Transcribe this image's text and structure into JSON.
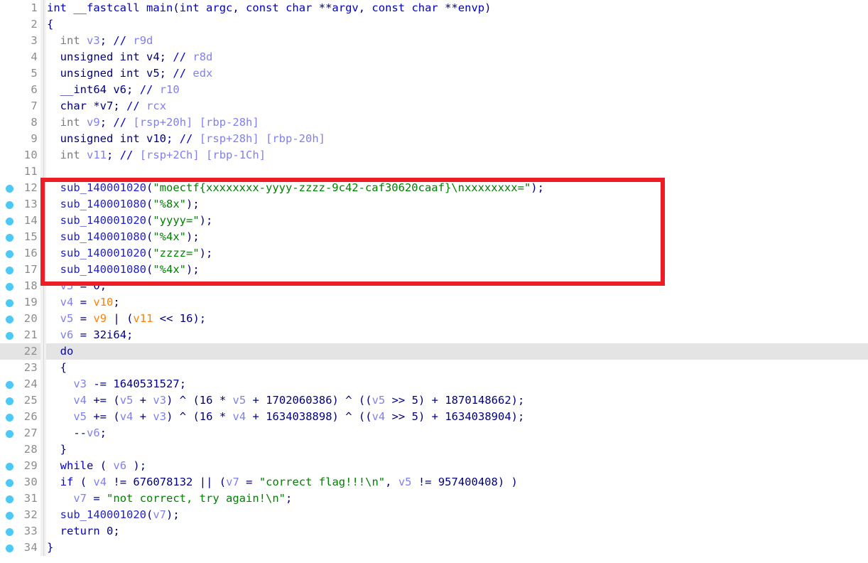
{
  "app": {
    "view_name": "pseudocode-view",
    "accent_breakpoint_color": "#4cc9f5",
    "annotation_color": "#ee1c25",
    "current_line_color": "#e4e4e4",
    "string_color": "#008000",
    "variable_color": "#8080f0",
    "variable_highlight_color": "#ff8000"
  },
  "annotation": {
    "name": "red-highlight-rectangle",
    "covers_lines": "12-18"
  },
  "code": {
    "language": "c-pseudocode",
    "first_line": 1,
    "last_line": 34,
    "current_line": 22,
    "lines": [
      {
        "n": "1",
        "bp": false,
        "html": "<span class=\"kw-blue\">int</span> <span class=\"kw-blue\">__fastcall</span> <span class=\"kw-blue\">main</span><span class=\"punct\">(</span><span class=\"kw-blue\">int</span> <span class=\"kw-blue\">argc</span><span class=\"punct\">,</span> <span class=\"kw-blue\">const</span> <span class=\"kw-blue\">char</span> <span class=\"punct\">**</span><span class=\"kw-blue\">argv</span><span class=\"punct\">,</span> <span class=\"kw-blue\">const</span> <span class=\"kw-blue\">char</span> <span class=\"punct\">**</span><span class=\"kw-blue\">envp</span><span class=\"punct\">)</span>"
      },
      {
        "n": "2",
        "bp": false,
        "html": "<span class=\"kw\">{</span>"
      },
      {
        "n": "3",
        "bp": false,
        "html": "  <span class=\"type-dim\">int</span> <span class=\"var\">v3</span><span class=\"kw\">;</span> <span class=\"cmt-mark\">//</span> <span class=\"cmt\">r9d</span>"
      },
      {
        "n": "4",
        "bp": false,
        "html": "  <span class=\"kw\">unsigned int</span> <span class=\"kw\">v4</span><span class=\"kw\">;</span> <span class=\"cmt-mark\">//</span> <span class=\"cmt\">r8d</span>"
      },
      {
        "n": "5",
        "bp": false,
        "html": "  <span class=\"kw\">unsigned int</span> <span class=\"kw\">v5</span><span class=\"kw\">;</span> <span class=\"cmt-mark\">//</span> <span class=\"cmt\">edx</span>"
      },
      {
        "n": "6",
        "bp": false,
        "html": "  <span class=\"kw\">__int64</span> <span class=\"kw\">v6</span><span class=\"kw\">;</span> <span class=\"cmt-mark\">//</span> <span class=\"cmt\">r10</span>"
      },
      {
        "n": "7",
        "bp": false,
        "html": "  <span class=\"kw\">char</span> <span class=\"kw\">*v7</span><span class=\"kw\">;</span> <span class=\"cmt-mark\">//</span> <span class=\"cmt\">rcx</span>"
      },
      {
        "n": "8",
        "bp": false,
        "html": "  <span class=\"type-dim\">int</span> <span class=\"var\">v9</span><span class=\"kw\">;</span> <span class=\"cmt-mark\">//</span> <span class=\"cmt\">[rsp+20h] [rbp-28h]</span>"
      },
      {
        "n": "9",
        "bp": false,
        "html": "  <span class=\"kw\">unsigned int</span> <span class=\"kw\">v10</span><span class=\"kw\">;</span> <span class=\"cmt-mark\">//</span> <span class=\"cmt\">[rsp+28h] [rbp-20h]</span>"
      },
      {
        "n": "10",
        "bp": false,
        "html": "  <span class=\"type-dim\">int</span> <span class=\"var\">v11</span><span class=\"kw\">;</span> <span class=\"cmt-mark\">//</span> <span class=\"cmt\">[rsp+2Ch] [rbp-1Ch]</span>"
      },
      {
        "n": "11",
        "bp": false,
        "html": ""
      },
      {
        "n": "12",
        "bp": true,
        "html": "  <span class=\"fn\">sub_140001020</span><span class=\"punct\">(</span><span class=\"str\">\"moectf{xxxxxxxx-yyyy-zzzz-9c42-caf30620caaf}\\nxxxxxxxx=\"</span><span class=\"punct\">);</span>"
      },
      {
        "n": "13",
        "bp": true,
        "html": "  <span class=\"fn\">sub_140001080</span><span class=\"punct\">(</span><span class=\"str\">\"%8x\"</span><span class=\"punct\">);</span>"
      },
      {
        "n": "14",
        "bp": true,
        "html": "  <span class=\"fn\">sub_140001020</span><span class=\"punct\">(</span><span class=\"str\">\"yyyy=\"</span><span class=\"punct\">);</span>"
      },
      {
        "n": "15",
        "bp": true,
        "html": "  <span class=\"fn\">sub_140001080</span><span class=\"punct\">(</span><span class=\"str\">\"%4x\"</span><span class=\"punct\">);</span>"
      },
      {
        "n": "16",
        "bp": true,
        "html": "  <span class=\"fn\">sub_140001020</span><span class=\"punct\">(</span><span class=\"str\">\"zzzz=\"</span><span class=\"punct\">);</span>"
      },
      {
        "n": "17",
        "bp": true,
        "html": "  <span class=\"fn\">sub_140001080</span><span class=\"punct\">(</span><span class=\"str\">\"%4x\"</span><span class=\"punct\">);</span>"
      },
      {
        "n": "18",
        "bp": true,
        "html": "  <span class=\"var\">v3</span> <span class=\"punct\">=</span> <span class=\"num\">0</span><span class=\"punct\">;</span>"
      },
      {
        "n": "19",
        "bp": true,
        "html": "  <span class=\"var\">v4</span> <span class=\"punct\">=</span> <span class=\"var-hl\">v10</span><span class=\"punct\">;</span>"
      },
      {
        "n": "20",
        "bp": true,
        "html": "  <span class=\"var\">v5</span> <span class=\"punct\">=</span> <span class=\"var-hl\">v9</span> <span class=\"punct\">|</span> <span class=\"punct\">(</span><span class=\"var-hl\">v11</span> <span class=\"punct\">&lt;&lt;</span> <span class=\"num\">16</span><span class=\"punct\">);</span>"
      },
      {
        "n": "21",
        "bp": true,
        "html": "  <span class=\"var\">v6</span> <span class=\"punct\">=</span> <span class=\"num\">32i64</span><span class=\"punct\">;</span>"
      },
      {
        "n": "22",
        "bp": false,
        "html": "  <span class=\"kw-blue\">do</span>"
      },
      {
        "n": "23",
        "bp": false,
        "html": "  <span class=\"kw\">{</span>"
      },
      {
        "n": "24",
        "bp": true,
        "html": "    <span class=\"var\">v3</span> <span class=\"punct\">-=</span> <span class=\"num\">1640531527</span><span class=\"punct\">;</span>"
      },
      {
        "n": "25",
        "bp": true,
        "html": "    <span class=\"var\">v4</span> <span class=\"punct\">+=</span> <span class=\"punct\">(</span><span class=\"var\">v5</span> <span class=\"punct\">+</span> <span class=\"var\">v3</span><span class=\"punct\">)</span> <span class=\"punct\">^</span> <span class=\"punct\">(</span><span class=\"num\">16</span> <span class=\"punct\">*</span> <span class=\"var\">v5</span> <span class=\"punct\">+</span> <span class=\"num\">1702060386</span><span class=\"punct\">)</span> <span class=\"punct\">^</span> <span class=\"punct\">((</span><span class=\"var\">v5</span> <span class=\"punct\">&gt;&gt;</span> <span class=\"num\">5</span><span class=\"punct\">)</span> <span class=\"punct\">+</span> <span class=\"num\">1870148662</span><span class=\"punct\">);</span>"
      },
      {
        "n": "26",
        "bp": true,
        "html": "    <span class=\"var\">v5</span> <span class=\"punct\">+=</span> <span class=\"punct\">(</span><span class=\"var\">v4</span> <span class=\"punct\">+</span> <span class=\"var\">v3</span><span class=\"punct\">)</span> <span class=\"punct\">^</span> <span class=\"punct\">(</span><span class=\"num\">16</span> <span class=\"punct\">*</span> <span class=\"var\">v4</span> <span class=\"punct\">+</span> <span class=\"num\">1634038898</span><span class=\"punct\">)</span> <span class=\"punct\">^</span> <span class=\"punct\">((</span><span class=\"var\">v4</span> <span class=\"punct\">&gt;&gt;</span> <span class=\"num\">5</span><span class=\"punct\">)</span> <span class=\"punct\">+</span> <span class=\"num\">1634038904</span><span class=\"punct\">);</span>"
      },
      {
        "n": "27",
        "bp": true,
        "html": "    <span class=\"punct\">--</span><span class=\"var\">v6</span><span class=\"punct\">;</span>"
      },
      {
        "n": "28",
        "bp": false,
        "html": "  <span class=\"kw\">}</span>"
      },
      {
        "n": "29",
        "bp": true,
        "html": "  <span class=\"kw-blue\">while</span> <span class=\"punct\">(</span> <span class=\"var\">v6</span> <span class=\"punct\">);</span>"
      },
      {
        "n": "30",
        "bp": true,
        "html": "  <span class=\"kw-blue\">if</span> <span class=\"punct\">(</span> <span class=\"var\">v4</span> <span class=\"punct\">!=</span> <span class=\"num\">676078132</span> <span class=\"punct\">||</span> <span class=\"punct\">(</span><span class=\"var\">v7</span> <span class=\"punct\">=</span> <span class=\"str\">\"correct flag!!!\\n\"</span><span class=\"punct\">,</span> <span class=\"var\">v5</span> <span class=\"punct\">!=</span> <span class=\"num\">957400408</span><span class=\"punct\">)</span> <span class=\"punct\">)</span>"
      },
      {
        "n": "31",
        "bp": true,
        "html": "    <span class=\"var\">v7</span> <span class=\"punct\">=</span> <span class=\"str\">\"not correct, try again!\\n\"</span><span class=\"punct\">;</span>"
      },
      {
        "n": "32",
        "bp": true,
        "html": "  <span class=\"fn\">sub_140001020</span><span class=\"punct\">(</span><span class=\"var\">v7</span><span class=\"punct\">);</span>"
      },
      {
        "n": "33",
        "bp": true,
        "html": "  <span class=\"kw-blue\">return</span> <span class=\"num\">0</span><span class=\"punct\">;</span>"
      },
      {
        "n": "34",
        "bp": true,
        "html": "<span class=\"kw\">}</span>"
      }
    ]
  }
}
